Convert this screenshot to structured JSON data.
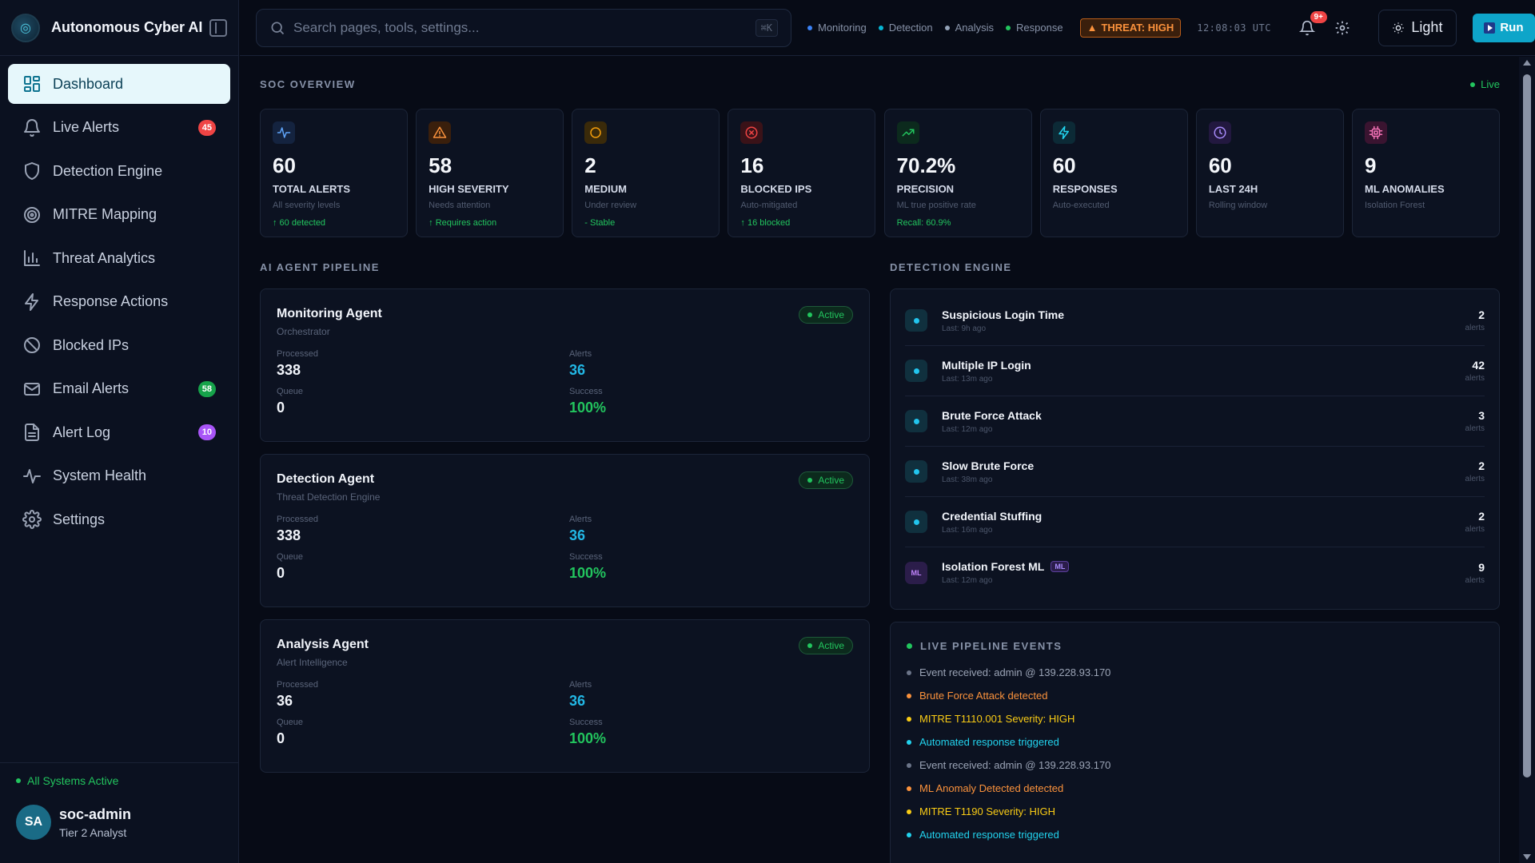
{
  "brand": {
    "name": "Autonomous Cyber AI"
  },
  "nav": [
    {
      "label": "Dashboard",
      "icon": "dashboard-icon",
      "badge": "",
      "active": true
    },
    {
      "label": "Live Alerts",
      "icon": "bell-icon",
      "badge": "45",
      "badge_color": "#ef4444"
    },
    {
      "label": "Detection Engine",
      "icon": "shield-icon",
      "badge": ""
    },
    {
      "label": "MITRE Mapping",
      "icon": "target-icon",
      "badge": ""
    },
    {
      "label": "Threat Analytics",
      "icon": "bar-chart-icon",
      "badge": ""
    },
    {
      "label": "Response Actions",
      "icon": "lightning-icon",
      "badge": ""
    },
    {
      "label": "Blocked IPs",
      "icon": "ban-icon",
      "badge": ""
    },
    {
      "label": "Email Alerts",
      "icon": "mail-icon",
      "badge": "58",
      "badge_color": "#16a34a"
    },
    {
      "label": "Alert Log",
      "icon": "file-icon",
      "badge": "10",
      "badge_color": "#a855f7"
    },
    {
      "label": "System Health",
      "icon": "pulse-icon",
      "badge": ""
    },
    {
      "label": "Settings",
      "icon": "gear-icon",
      "badge": ""
    }
  ],
  "footer": {
    "status": "All Systems Active",
    "user_initials": "SA",
    "user_name": "soc-admin",
    "user_role": "Tier 2 Analyst"
  },
  "topbar": {
    "search_placeholder": "Search pages, tools, settings...",
    "search_shortcut": "⌘K",
    "agents": [
      {
        "label": "Monitoring",
        "color": "#3b82f6"
      },
      {
        "label": "Detection",
        "color": "#06b6d4"
      },
      {
        "label": "Analysis",
        "color": "#94a3b8"
      },
      {
        "label": "Response",
        "color": "#22c55e"
      }
    ],
    "threat": "THREAT: HIGH",
    "clock": "12:08:03 UTC",
    "notif_count": "9+",
    "theme_label": "Light",
    "run_label": "Run"
  },
  "overview": {
    "title": "SOC OVERVIEW",
    "live_label": "Live",
    "cards": [
      {
        "value": "60",
        "label": "TOTAL ALERTS",
        "sub": "All severity levels",
        "trend": "↑ 60 detected",
        "icon": "pulse-icon",
        "color": "#60a5fa",
        "bg": "#14233f"
      },
      {
        "value": "58",
        "label": "HIGH SEVERITY",
        "sub": "Needs attention",
        "trend": "↑ Requires action",
        "icon": "warning-icon",
        "color": "#fb923c",
        "bg": "#3a1f0c"
      },
      {
        "value": "2",
        "label": "MEDIUM",
        "sub": "Under review",
        "trend": "- Stable",
        "icon": "circle-icon",
        "color": "#f59e0b",
        "bg": "#3a2a0a"
      },
      {
        "value": "16",
        "label": "BLOCKED IPS",
        "sub": "Auto-mitigated",
        "trend": "↑ 16 blocked",
        "icon": "x-circle-icon",
        "color": "#ef4444",
        "bg": "#3a1218"
      },
      {
        "value": "70.2%",
        "label": "PRECISION",
        "sub": "ML true positive rate",
        "trend": "Recall: 60.9%",
        "icon": "trend-up-icon",
        "color": "#22c55e",
        "bg": "#0c2a1d"
      },
      {
        "value": "60",
        "label": "RESPONSES",
        "sub": "Auto-executed",
        "trend": "",
        "icon": "lightning-icon",
        "color": "#22d3ee",
        "bg": "#0c2a36"
      },
      {
        "value": "60",
        "label": "LAST 24H",
        "sub": "Rolling window",
        "trend": "",
        "icon": "clock-icon",
        "color": "#a78bfa",
        "bg": "#22183f"
      },
      {
        "value": "9",
        "label": "ML ANOMALIES",
        "sub": "Isolation Forest",
        "trend": "",
        "icon": "chip-icon",
        "color": "#f472b6",
        "bg": "#3a1430"
      }
    ]
  },
  "pipeline": {
    "title": "AI AGENT PIPELINE",
    "metric_labels": {
      "processed": "Processed",
      "alerts": "Alerts",
      "queue": "Queue",
      "success": "Success"
    },
    "agents": [
      {
        "name": "Monitoring Agent",
        "role": "Orchestrator",
        "status": "Active",
        "processed": "338",
        "alerts": "36",
        "queue": "0",
        "success": "100%"
      },
      {
        "name": "Detection Agent",
        "role": "Threat Detection Engine",
        "status": "Active",
        "processed": "338",
        "alerts": "36",
        "queue": "0",
        "success": "100%"
      },
      {
        "name": "Analysis Agent",
        "role": "Alert Intelligence",
        "status": "Active",
        "processed": "36",
        "alerts": "36",
        "queue": "0",
        "success": "100%"
      }
    ]
  },
  "detection": {
    "title": "DETECTION ENGINE",
    "count_label": "alerts",
    "rules": [
      {
        "name": "Suspicious Login Time",
        "last": "Last: 9h ago",
        "count": "2",
        "ml": false
      },
      {
        "name": "Multiple IP Login",
        "last": "Last: 13m ago",
        "count": "42",
        "ml": false
      },
      {
        "name": "Brute Force Attack",
        "last": "Last: 12m ago",
        "count": "3",
        "ml": false
      },
      {
        "name": "Slow Brute Force",
        "last": "Last: 38m ago",
        "count": "2",
        "ml": false
      },
      {
        "name": "Credential Stuffing",
        "last": "Last: 16m ago",
        "count": "2",
        "ml": false
      },
      {
        "name": "Isolation Forest ML",
        "last": "Last: 12m ago",
        "count": "9",
        "ml": true,
        "icon_text": "ML",
        "tag": "ML"
      }
    ]
  },
  "events": {
    "title": "LIVE PIPELINE EVENTS",
    "items": [
      {
        "text": "Event received: admin @ 139.228.93.170",
        "color": "#9aa3b5",
        "dot": "#6b7488"
      },
      {
        "text": "Brute Force Attack detected",
        "color": "#fb923c",
        "dot": "#fb923c"
      },
      {
        "text": "MITRE T1110.001 Severity: HIGH",
        "color": "#facc15",
        "dot": "#facc15"
      },
      {
        "text": "Automated response triggered",
        "color": "#22d3ee",
        "dot": "#22d3ee"
      },
      {
        "text": "Event received: admin @ 139.228.93.170",
        "color": "#9aa3b5",
        "dot": "#6b7488"
      },
      {
        "text": "ML Anomaly Detected detected",
        "color": "#fb923c",
        "dot": "#fb923c"
      },
      {
        "text": "MITRE T1190 Severity: HIGH",
        "color": "#facc15",
        "dot": "#facc15"
      },
      {
        "text": "Automated response triggered",
        "color": "#22d3ee",
        "dot": "#22d3ee"
      }
    ]
  }
}
